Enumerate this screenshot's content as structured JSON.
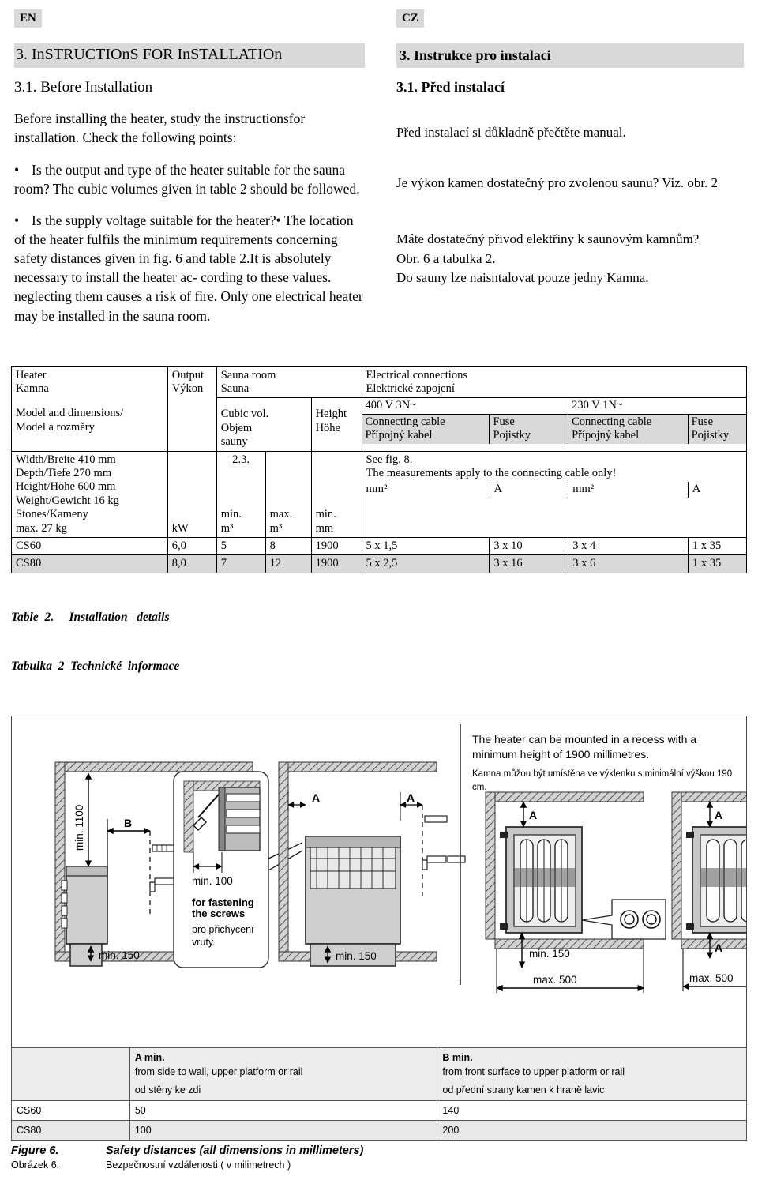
{
  "left": {
    "lang": "EN",
    "section_heading": "3. InSTRUCTIOnS FOR InSTALLATIOn",
    "sub_heading": "3.1. Before  Installation",
    "intro": "Before  installing the  heater, study the  instructionsfor installation. Check the  following points:",
    "bullet1": "Is the  output and  type of the  heater suitable for the  sauna room? The cubic  volumes given  in table 2 should  be followed.",
    "bullet2": "Is the  supply voltage suitable for the  heater?• The  location of the  heater fulfils the  minimum requirements concerning safety distances given in fig. 6 and  table 2.It is absolutely necessary to install the heater ac- cording  to  these  values. neglecting them causes a risk of fire. Only one electrical heater may be installed  in the sauna  room."
  },
  "right": {
    "lang": "CZ",
    "section_heading": "3. Instrukce pro instalaci",
    "sub_heading": "3.1.  Před instalací",
    "para1": "Před instalací si důkladně přečtěte manual.",
    "para2": "Je výkon kamen dostatečný pro zvolenou saunu? Viz. obr. 2",
    "para3": "Máte dostatečný přivod elektřiny k saunovým kamnům?\nObr. 6 a tabulka 2.\nDo sauny lze naisntalovat pouze jedny Kamna."
  },
  "spec_table": {
    "h_heater_en": "Heater",
    "h_heater_cz": "Kamna",
    "h_model_en": "Model  and dimensions/",
    "h_model_cz": "Model a rozměry",
    "h_output_en": "Output",
    "h_output_cz": "Výkon",
    "h_sauna_en": "Sauna  room",
    "h_sauna_cz": "Sauna",
    "h_cubic_en": "Cubic   vol.",
    "h_cubic_cz": "Objem",
    "h_cubic_cz2": "sauny",
    "h_height_en": "Height",
    "h_height_cz": "Höhe",
    "h_elec_en": "Electrical connections",
    "h_elec_cz": "Elektrické zapojení",
    "h_400v": "400 V  3N~",
    "h_230v": "230 V  1N~",
    "h_cable_en": "Connecting cable",
    "h_cable_cz": "Přípojný kabel",
    "h_fuse_en": "Fuse",
    "h_fuse_cz": "Pojistky",
    "dims": [
      "Width/Breite  410 mm",
      "Depth/Tiefe  270  mm",
      "Height/Höhe 600 mm",
      "Weight/Gewicht 16  kg",
      "Stones/Kameny",
      "max.  27  kg"
    ],
    "ref_23": "2.3.",
    "note_fig8": "See  fig.  8.",
    "note_measurements": "The  measurements apply  to  the  connecting cable only!",
    "unit_kw": "kW",
    "unit_min": "min.",
    "unit_max": "max.",
    "unit_min2": "min.",
    "unit_m3": "m³",
    "unit_m3b": "m³",
    "unit_mm": "mm",
    "unit_mm2_a": "mm²",
    "unit_a_a": "A",
    "unit_mm2_b": "mm²",
    "unit_a_b": "A",
    "rows": [
      {
        "model": "CS60",
        "output": "6,0",
        "min_m3": "5",
        "max_m3": "8",
        "height_mm": "1900",
        "cable400": "5 x 1,5",
        "fuse400": "3 x 10",
        "cable230": "3 x 4",
        "fuse230": "1 x 35",
        "shaded": false
      },
      {
        "model": "CS80",
        "output": "8,0",
        "min_m3": "7",
        "max_m3": "12",
        "height_mm": "1900",
        "cable400": "5 x 2,5",
        "fuse400": "3 x 16",
        "cable230": "3 x 6",
        "fuse230": "1 x 35",
        "shaded": true
      }
    ],
    "caption_en": "Table  2.     Installation   details",
    "caption_cz": "Tabulka  2  Technické  informace"
  },
  "figure": {
    "recess_note_en": "The heater can be mounted in a recess with a minimum height of 1900 millimetres.",
    "recess_note_cz": "Kamna můžou být umístěna ve výklenku s minimální výškou 190 cm.",
    "labels": {
      "min1100": "min. 1100",
      "min150_a": "min. 150",
      "min150_b": "min. 150",
      "min150_c": "min. 150",
      "min100": "min. 100",
      "max500_a": "max. 500",
      "max500_b": "max. 500",
      "letter_a1": "A",
      "letter_a2": "A",
      "letter_a3": "A",
      "letter_a4": "A",
      "letter_a5": "A",
      "letter_b": "B",
      "screws_en": "for fastening\nthe screws",
      "screws_cz": "pro přichycení\nvruty."
    },
    "ab_table": {
      "a_title": "A min.",
      "a_desc_en": "from side to wall, upper platform or rail",
      "a_desc_cz": "od stěny ke zdi",
      "b_title": "B min.",
      "b_desc_en": "from front surface to upper platform or rail",
      "b_desc_cz": "od přední strany kamen k hraně lavic",
      "rows": [
        {
          "model": "CS60",
          "a": "50",
          "b": "140",
          "shaded": false
        },
        {
          "model": "CS80",
          "a": "100",
          "b": "200",
          "shaded": true
        }
      ]
    },
    "caption_en_lbl": "Figure 6.",
    "caption_en_txt": "Safety distances (all dimensions in millimeters)",
    "caption_cz_lbl": "Obrázek 6.",
    "caption_cz_txt": "Bezpečnostní vzdálenosti ( v milimetrech )"
  }
}
